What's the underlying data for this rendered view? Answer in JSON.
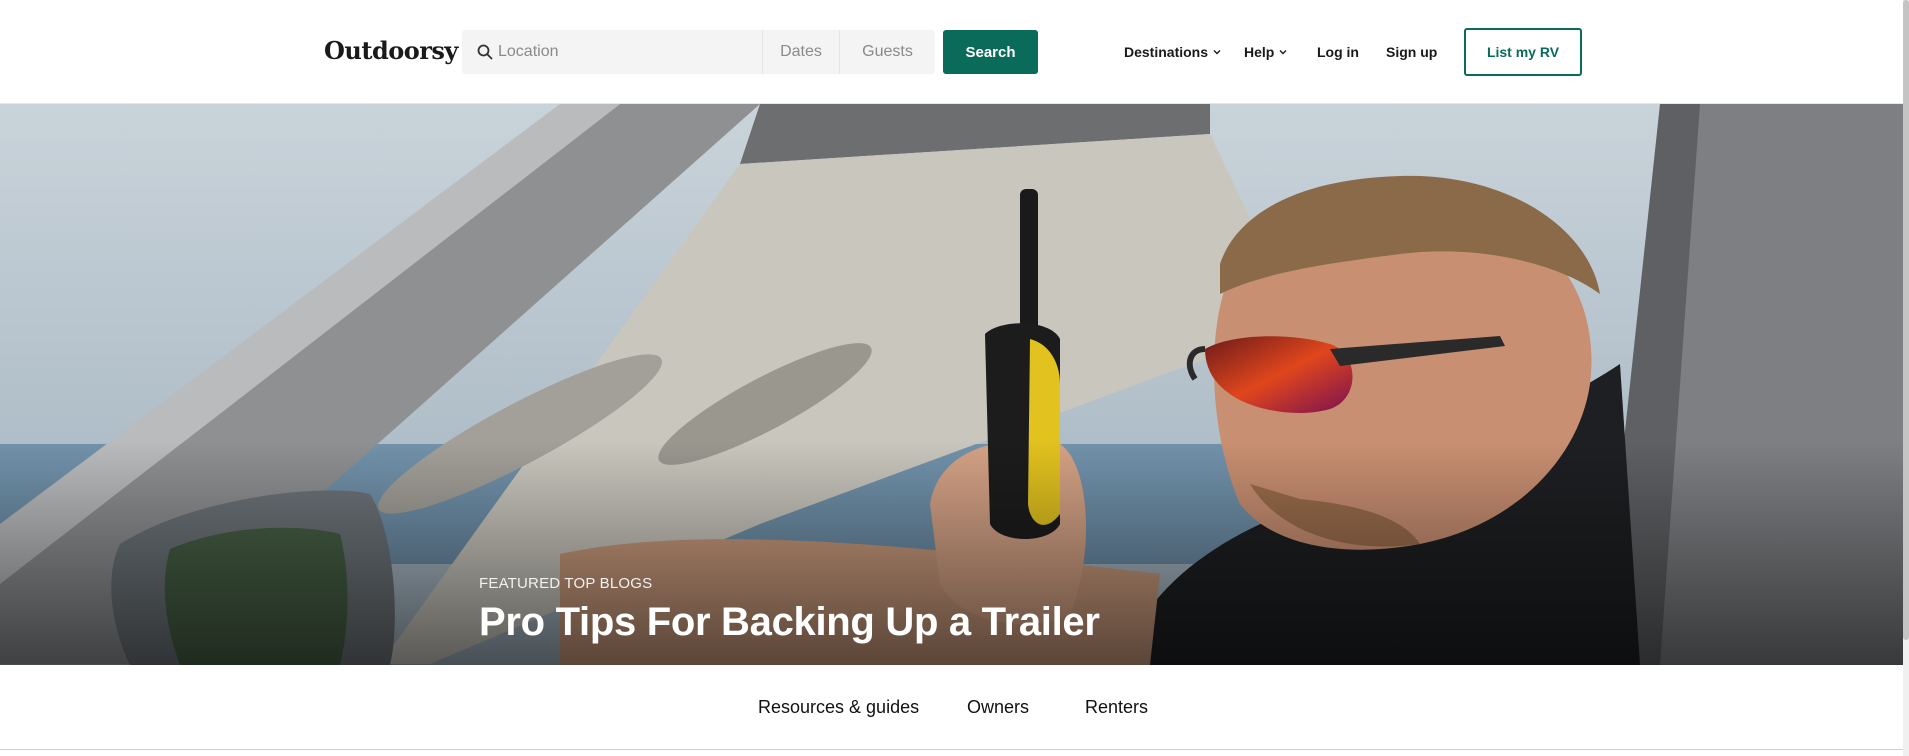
{
  "header": {
    "logo_text": "Outdoorsy",
    "search": {
      "location_placeholder": "Location",
      "dates_label": "Dates",
      "guests_label": "Guests",
      "button_label": "Search"
    },
    "nav": {
      "destinations": "Destinations",
      "help": "Help",
      "login": "Log in",
      "signup": "Sign up",
      "list_rv": "List my RV"
    }
  },
  "hero": {
    "eyebrow": "FEATURED TOP BLOGS",
    "title": "Pro Tips For Backing Up a Trailer"
  },
  "tabs": [
    {
      "label": "Resources & guides"
    },
    {
      "label": "Owners"
    },
    {
      "label": "Renters"
    }
  ],
  "colors": {
    "brand": "#0a6b5b",
    "text": "#1a1a1a"
  },
  "icons": {
    "search": "magnifier",
    "dropdown": "chevron-down"
  }
}
